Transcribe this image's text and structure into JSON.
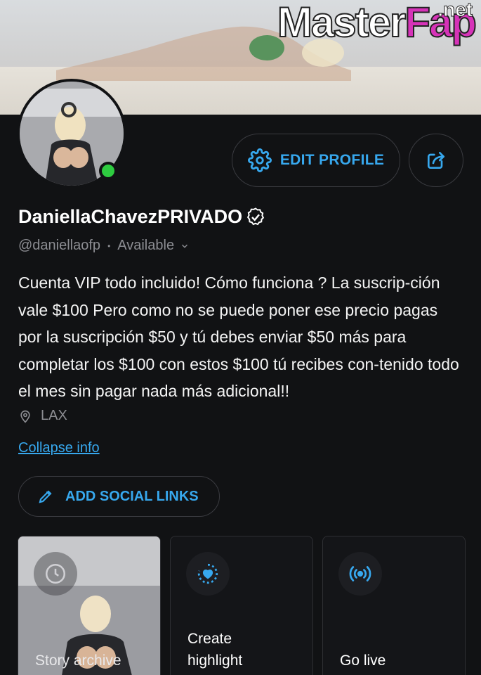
{
  "watermark": {
    "part1": "Master",
    "part2": "Fap",
    "suffix": ".net"
  },
  "profile": {
    "name": "DaniellaChavezPRIVADO",
    "handle": "@daniellaofp",
    "separator": "•",
    "status": "Available",
    "bio": "Cuenta VIP todo incluido! Cómo funciona ? La suscrip-ción vale $100 Pero como no se puede poner ese precio pagas por la suscripción $50 y tú debes enviar $50 más para completar los $100 con estos $100 tú recibes con-tenido todo el mes sin pagar nada más adicional!!",
    "location": "LAX",
    "collapse_label": "Collapse info"
  },
  "buttons": {
    "edit_profile": "EDIT PROFILE",
    "add_social_links": "ADD SOCIAL LINKS"
  },
  "cards": [
    {
      "label": "Story archive",
      "icon": "clock-icon"
    },
    {
      "label": "Create highlight",
      "icon": "heart-circle-icon"
    },
    {
      "label": "Go live",
      "icon": "broadcast-icon"
    }
  ],
  "colors": {
    "accent": "#37a8ee",
    "background": "#111214",
    "online": "#2ecc40",
    "verified": "#ffffff"
  }
}
